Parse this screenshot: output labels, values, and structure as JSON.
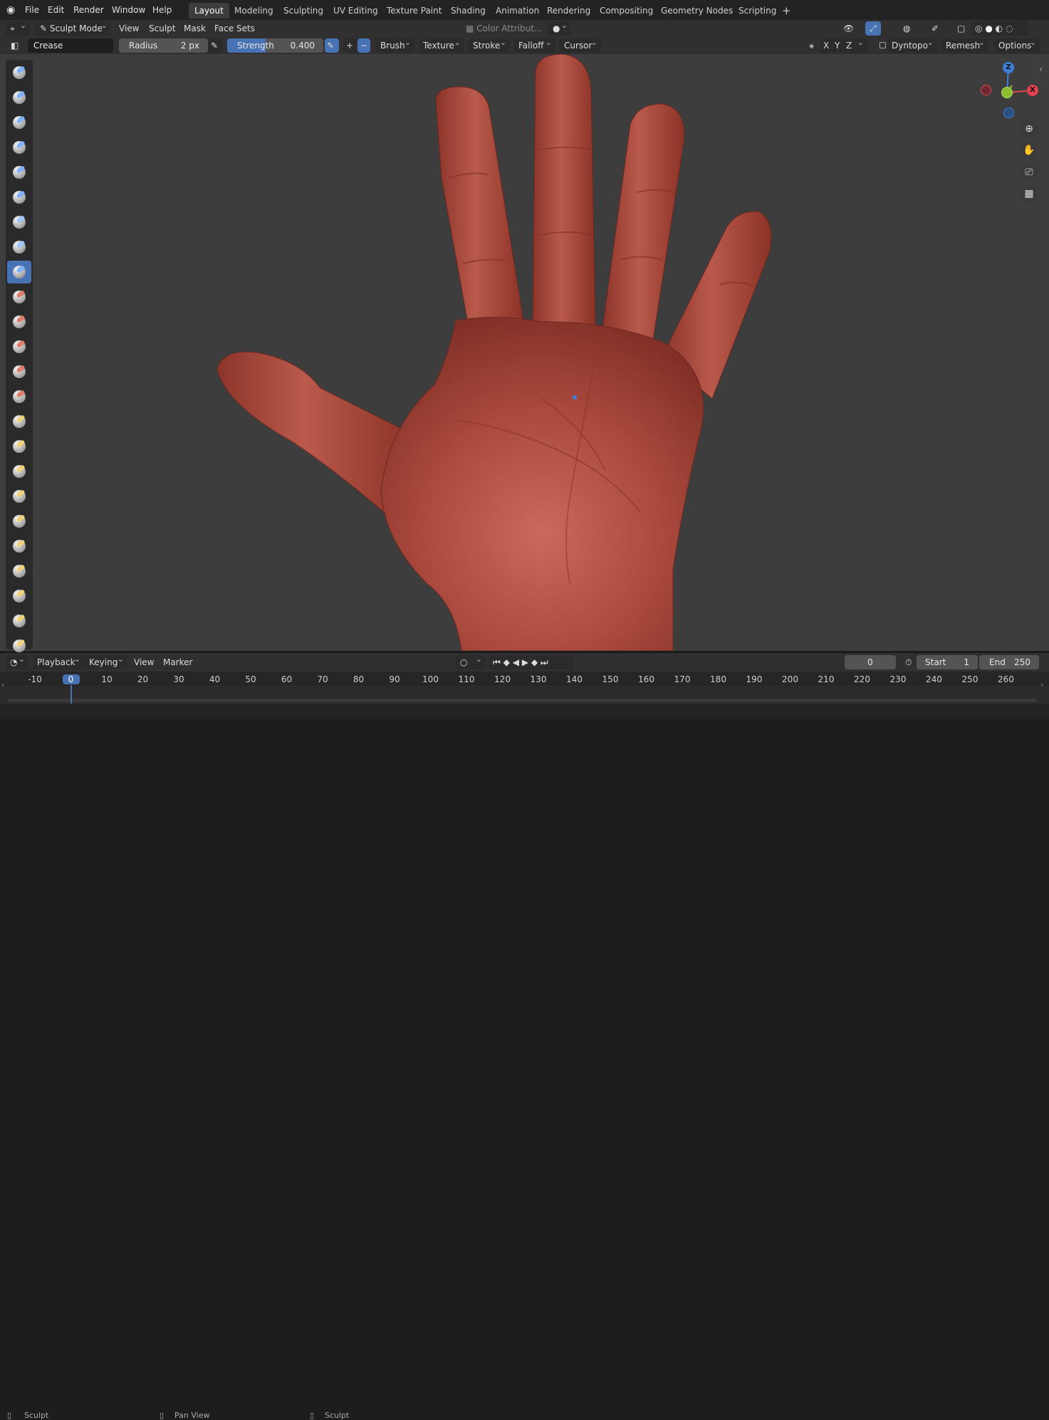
{
  "menu": {
    "file": "File",
    "edit": "Edit",
    "render": "Render",
    "window": "Window",
    "help": "Help"
  },
  "workspaces": [
    {
      "label": "Layout",
      "active": true
    },
    {
      "label": "Modeling"
    },
    {
      "label": "Sculpting"
    },
    {
      "label": "UV Editing"
    },
    {
      "label": "Texture Paint"
    },
    {
      "label": "Shading"
    },
    {
      "label": "Animation"
    },
    {
      "label": "Rendering"
    },
    {
      "label": "Compositing"
    },
    {
      "label": "Geometry Nodes"
    },
    {
      "label": "Scripting"
    }
  ],
  "header": {
    "mode": "Sculpt Mode",
    "view": "View",
    "sculpt": "Sculpt",
    "mask": "Mask",
    "face_sets": "Face Sets",
    "color_attribute": "Color Attribut..."
  },
  "tool_settings": {
    "brush_name": "Crease",
    "radius_label": "Radius",
    "radius_value": "2 px",
    "strength_label": "Strength",
    "strength_value": "0.400",
    "strength_fraction": 0.4,
    "brush": "Brush",
    "texture": "Texture",
    "stroke": "Stroke",
    "falloff": "Falloff",
    "cursor": "Cursor",
    "axis_x": "X",
    "axis_y": "Y",
    "axis_z": "Z",
    "dyntopo": "Dyntopo",
    "remesh": "Remesh",
    "options": "Options"
  },
  "tools_active_index": 8,
  "gizmo": {
    "z": "Z",
    "y": "Y",
    "x": "X"
  },
  "timeline": {
    "playback": "Playback",
    "keying": "Keying",
    "view": "View",
    "marker": "Marker",
    "current_frame": "0",
    "start_label": "Start",
    "start_value": "1",
    "end_label": "End",
    "end_value": "250",
    "ticks": [
      "-10",
      "0",
      "10",
      "20",
      "30",
      "40",
      "50",
      "60",
      "70",
      "80",
      "90",
      "100",
      "110",
      "120",
      "130",
      "140",
      "150",
      "160",
      "170",
      "180",
      "190",
      "200",
      "210",
      "220",
      "230",
      "240",
      "250",
      "260"
    ]
  },
  "statusbar": {
    "left": "Sculpt",
    "middle": "Pan View",
    "right": "Sculpt"
  },
  "colors": {
    "accent": "#4772b3",
    "skin": "#a9483c",
    "x_axis": "#e2434f",
    "y_axis": "#8bbd2c",
    "z_axis": "#3d7fd8"
  }
}
